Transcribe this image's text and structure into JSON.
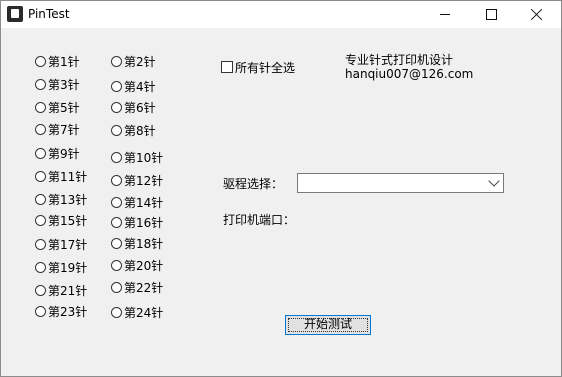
{
  "window": {
    "title": "PinTest",
    "controls": {
      "minimize": "minimize",
      "maximize": "maximize",
      "close": "close"
    }
  },
  "pins_left": [
    "第1针",
    "第3针",
    "第5针",
    "第7针",
    "第9针",
    "第11针",
    "第13针",
    "第15针",
    "第17针",
    "第19针",
    "第21针",
    "第23针"
  ],
  "pins_right": [
    "第2针",
    "第4针",
    "第6针",
    "第8针",
    "第10针",
    "第12针",
    "第14针",
    "第16针",
    "第18针",
    "第20针",
    "第22针",
    "第24针"
  ],
  "select_all_label": "所有针全选",
  "info": {
    "line1": "专业针式打印机设计",
    "line2": "hanqiu007@126.com"
  },
  "driver_label": "驱程选择：",
  "driver_value": "",
  "port_label": "打印机端口：",
  "port_value": "",
  "start_button": "开始测试"
}
